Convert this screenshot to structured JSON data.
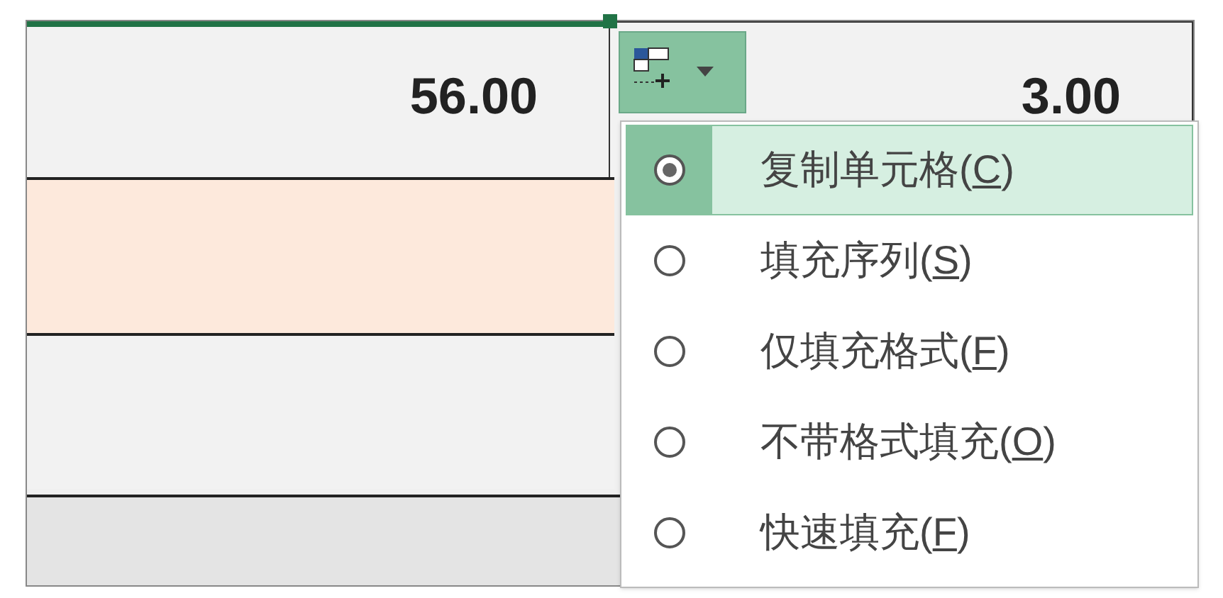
{
  "cells": [
    {
      "value": "56.00",
      "selected": true
    },
    {
      "value": "3.00",
      "selected": false
    }
  ],
  "rows": [
    {
      "color": "#fde9dc"
    },
    {
      "color": "#f2f2f2"
    }
  ],
  "menu": {
    "items": [
      {
        "label": "复制单元格(C)",
        "selected": true
      },
      {
        "label": "填充序列(S)",
        "selected": false
      },
      {
        "label": "仅填充格式(F)",
        "selected": false
      },
      {
        "label": "不带格式填充(O)",
        "selected": false
      },
      {
        "label": "快速填充(F)",
        "selected": false
      }
    ]
  }
}
